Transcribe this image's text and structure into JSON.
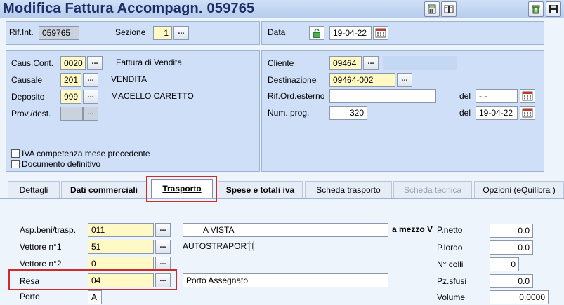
{
  "window": {
    "title": "Modifica Fattura Accompagn. 059765"
  },
  "header": {
    "rif_int_label": "Rif.Int.",
    "rif_int_value": "059765",
    "sezione_label": "Sezione",
    "sezione_value": "1",
    "data_label": "Data",
    "data_value": "19-04-22"
  },
  "left_panel": {
    "caus_cont_label": "Caus.Cont.",
    "caus_cont_value": "0020",
    "caus_cont_desc": "Fattura di Vendita",
    "causale_label": "Causale",
    "causale_value": "201",
    "causale_desc": "VENDITA",
    "deposito_label": "Deposito",
    "deposito_value": "999",
    "deposito_desc": "MACELLO CARETTO",
    "prov_dest_label": "Prov./dest.",
    "iva_label": "IVA competenza mese precedente",
    "doc_def_label": "Documento definitivo"
  },
  "right_panel": {
    "cliente_label": "Cliente",
    "cliente_value": "09464",
    "destinazione_label": "Destinazione",
    "destinazione_value": "09464-002",
    "rif_ord_label": "Rif.Ord.esterno",
    "del_label": "del",
    "del_value_1": "- -",
    "num_prog_label": "Num. prog.",
    "num_prog_value": "320",
    "del_value_2": "19-04-22"
  },
  "tabs": [
    {
      "label": "Dettagli"
    },
    {
      "label": "Dati commerciali"
    },
    {
      "label": "Trasporto"
    },
    {
      "label": "Spese e totali iva"
    },
    {
      "label": "Scheda trasporto"
    },
    {
      "label": "Scheda tecnica"
    },
    {
      "label": "Opzioni (eQuilibra )"
    }
  ],
  "trasporto": {
    "asp_label": "Asp.beni/trasp.",
    "asp_value": "011",
    "asp_desc": "A VISTA",
    "mezzo_label": "a mezzo V",
    "vettore1_label": "Vettore n°1",
    "vettore1_value": "51",
    "vettore1_desc": "AUTOSTRAPORTI",
    "vettore2_label": "Vettore n°2",
    "vettore2_value": "0",
    "resa_label": "Resa",
    "resa_value": "04",
    "resa_desc": "Porto Assegnato",
    "porto_label": "Porto",
    "porto_value": "A",
    "pnetto_label": "P.netto",
    "pnetto_value": "0.0",
    "plordo_label": "P.lordo",
    "plordo_value": "0.0",
    "ncolli_label": "N° colli",
    "ncolli_value": "0",
    "pzsfusi_label": "Pz.sfusi",
    "pzsfusi_value": "0.0",
    "volume_label": "Volume",
    "volume_value": "0.0000"
  },
  "icons": {
    "toolbar": [
      "calculator-icon",
      "split-view-icon",
      "recycle-bin-icon",
      "save-icon"
    ],
    "lock": "unlock-icon",
    "calendar": "calendar-icon"
  },
  "colors": {
    "title": "#1c2d66",
    "panel": "#cfdff7",
    "field_yellow": "#fff9c6",
    "highlight_red": "#d22a2a"
  }
}
